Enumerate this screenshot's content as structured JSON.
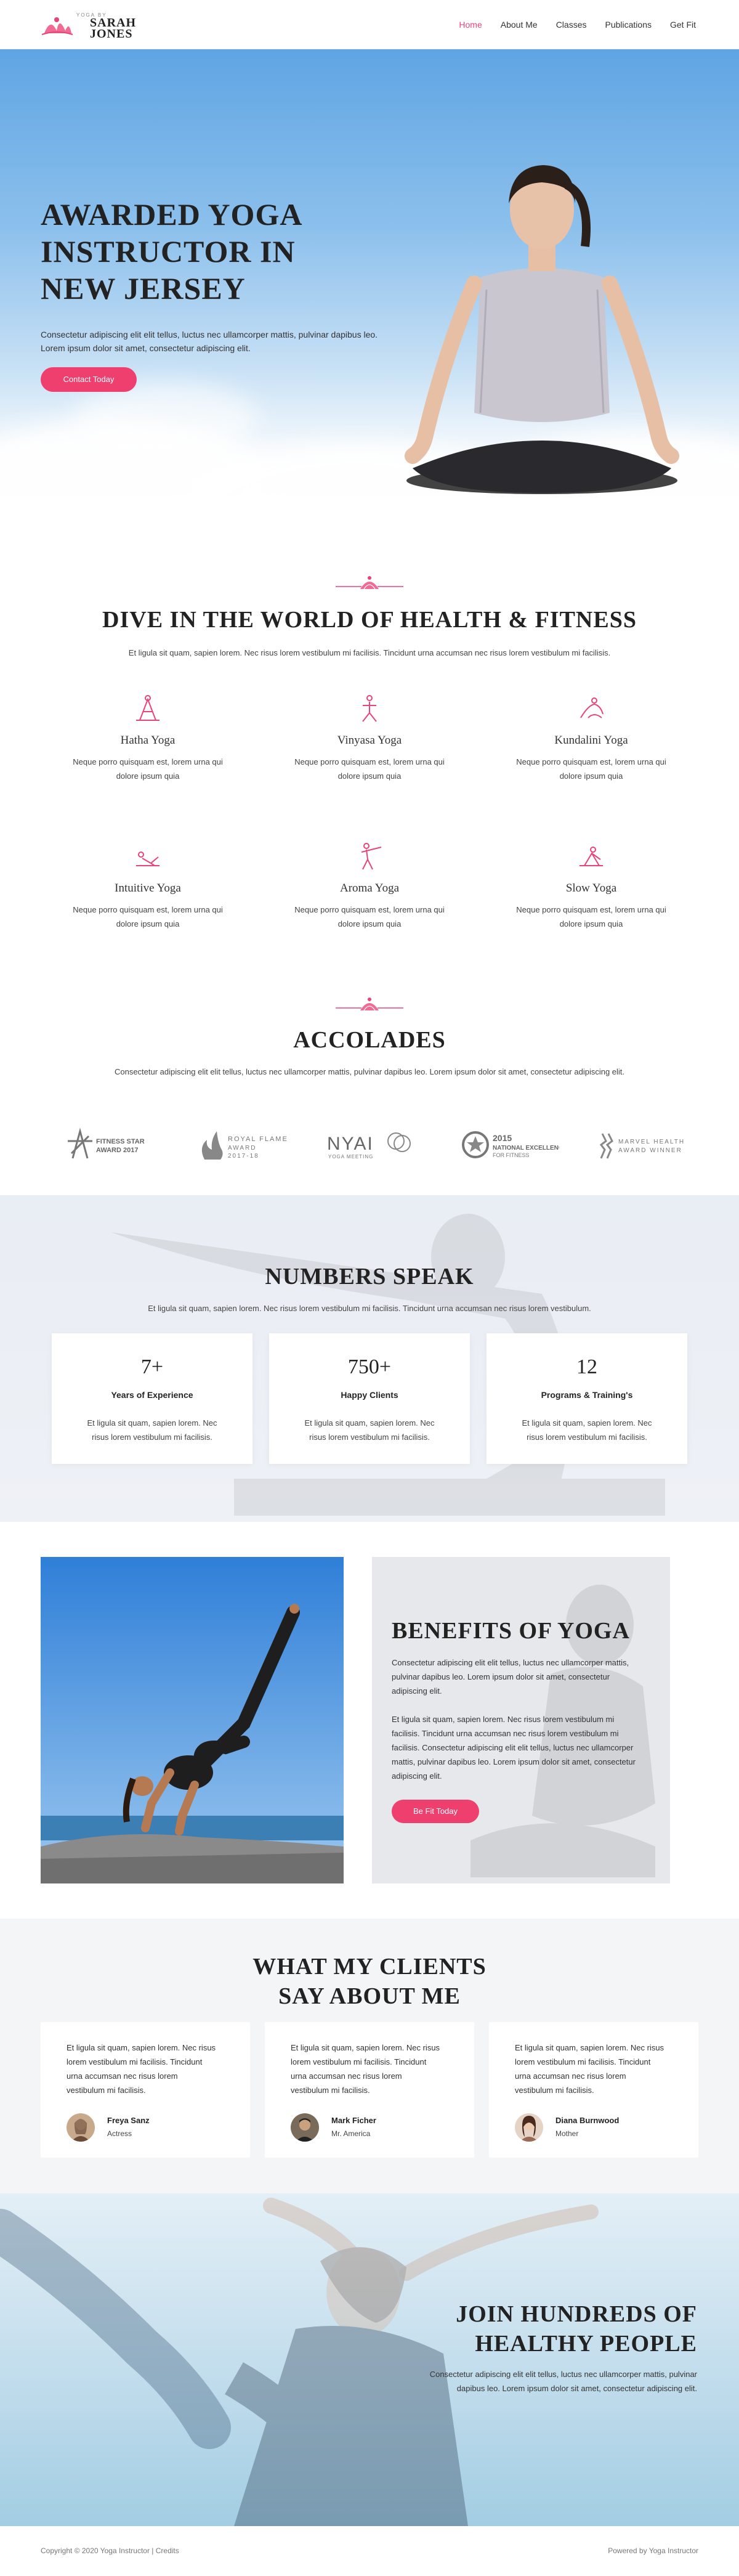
{
  "brand": {
    "tagline": "YOGA BY",
    "name_line1": "SARAH",
    "name_line2": "JONES",
    "accent_color": "#ef3f6f"
  },
  "nav": {
    "items": [
      {
        "label": "Home",
        "active": true
      },
      {
        "label": "About Me",
        "active": false
      },
      {
        "label": "Classes",
        "active": false
      },
      {
        "label": "Publications",
        "active": false
      },
      {
        "label": "Get Fit",
        "active": false
      }
    ]
  },
  "hero": {
    "title_line1": "AWARDED YOGA",
    "title_line2": "INSTRUCTOR IN",
    "title_line3": "NEW JERSEY",
    "desc_line1": "Consectetur adipiscing elit elit tellus, luctus nec ullamcorper mattis, pulvinar dapibus leo.",
    "desc_line2": "Lorem ipsum dolor sit amet, consectetur adipiscing elit.",
    "button": "Contact Today"
  },
  "services": {
    "title": "DIVE IN THE WORLD OF HEALTH & FITNESS",
    "subtitle": "Et ligula sit quam, sapien lorem. Nec risus lorem vestibulum mi facilisis. Tincidunt urna accumsan nec risus lorem vestibulum mi facilisis.",
    "items": [
      {
        "title": "Hatha Yoga",
        "desc_line1": "Neque porro quisquam est, lorem urna qui",
        "desc_line2": "dolore ipsum quia",
        "icon": "hatha-pose-icon"
      },
      {
        "title": "Vinyasa Yoga",
        "desc_line1": "Neque porro quisquam est, lorem urna qui",
        "desc_line2": "dolore ipsum quia",
        "icon": "vinyasa-pose-icon"
      },
      {
        "title": "Kundalini Yoga",
        "desc_line1": "Neque porro quisquam est, lorem urna qui",
        "desc_line2": "dolore ipsum quia",
        "icon": "kundalini-pose-icon"
      },
      {
        "title": "Intuitive Yoga",
        "desc_line1": "Neque porro quisquam est, lorem urna qui",
        "desc_line2": "dolore ipsum quia",
        "icon": "intuitive-pose-icon"
      },
      {
        "title": "Aroma Yoga",
        "desc_line1": "Neque porro quisquam est, lorem urna qui",
        "desc_line2": "dolore ipsum quia",
        "icon": "aroma-pose-icon"
      },
      {
        "title": "Slow Yoga",
        "desc_line1": "Neque porro quisquam est, lorem urna qui",
        "desc_line2": "dolore ipsum quia",
        "icon": "slow-pose-icon"
      }
    ]
  },
  "accolades": {
    "title": "ACCOLADES",
    "subtitle": "Consectetur adipiscing elit elit tellus, luctus nec ullamcorper mattis, pulvinar dapibus leo. Lorem ipsum dolor sit amet, consectetur adipiscing elit.",
    "awards": [
      {
        "line1": "FITNESS STAR",
        "line2": "AWARD 2017"
      },
      {
        "line1": "ROYAL FLAME",
        "line2": "AWARD",
        "line3": "2017-18"
      },
      {
        "line1": "NYAI",
        "line2": "YOGA MEETING"
      },
      {
        "line1": "2015",
        "line2": "NATIONAL EXCELLENCE",
        "line3": "FOR FITNESS"
      },
      {
        "line1": "MARVEL HEALTH",
        "line2": "AWARD WINNER"
      }
    ]
  },
  "numbers": {
    "title": "NUMBERS SPEAK",
    "subtitle": "Et ligula sit quam, sapien lorem. Nec risus lorem vestibulum mi facilisis. Tincidunt urna accumsan nec risus lorem vestibulum.",
    "stats": [
      {
        "value": "7+",
        "label": "Years of Experience",
        "desc_line1": "Et ligula sit quam, sapien lorem. Nec",
        "desc_line2": "risus lorem vestibulum mi facilisis."
      },
      {
        "value": "750+",
        "label": "Happy Clients",
        "desc_line1": "Et ligula sit quam, sapien lorem. Nec",
        "desc_line2": "risus lorem vestibulum mi facilisis."
      },
      {
        "value": "12",
        "label": "Programs & Training's",
        "desc_line1": "Et ligula sit quam, sapien lorem. Nec",
        "desc_line2": "risus lorem vestibulum mi facilisis."
      }
    ]
  },
  "benefits": {
    "title": "BENEFITS OF YOGA",
    "p1_line1": "Consectetur adipiscing elit elit tellus, luctus nec ullamcorper mattis,",
    "p1_line2": "pulvinar dapibus leo. Lorem ipsum dolor sit amet, consectetur",
    "p1_line3": "adipiscing elit.",
    "p2_line1": "Et ligula sit quam, sapien lorem. Nec risus lorem vestibulum mi",
    "p2_line2": "facilisis. Tincidunt urna accumsan nec risus lorem vestibulum mi",
    "p2_line3": "facilisis. Consectetur adipiscing elit elit tellus, luctus nec ullamcorper",
    "p2_line4": "mattis, pulvinar dapibus leo. Lorem ipsum dolor sit amet, consectetur",
    "p2_line5": "adipiscing elit.",
    "button": "Be Fit Today"
  },
  "testimonials": {
    "title_line1": "WHAT MY CLIENTS",
    "title_line2": "SAY ABOUT ME",
    "items": [
      {
        "text_line1": "Et ligula sit quam, sapien lorem. Nec risus",
        "text_line2": "lorem vestibulum mi facilisis. Tincidunt",
        "text_line3": "urna accumsan nec risus lorem",
        "text_line4": "vestibulum mi facilisis.",
        "name": "Freya Sanz",
        "role": "Actress"
      },
      {
        "text_line1": "Et ligula sit quam, sapien lorem. Nec risus",
        "text_line2": "lorem vestibulum mi facilisis. Tincidunt",
        "text_line3": "urna accumsan nec risus lorem",
        "text_line4": "vestibulum mi facilisis.",
        "name": "Mark Ficher",
        "role": "Mr. America"
      },
      {
        "text_line1": "Et ligula sit quam, sapien lorem. Nec risus",
        "text_line2": "lorem vestibulum mi facilisis. Tincidunt",
        "text_line3": "urna accumsan nec risus lorem",
        "text_line4": "vestibulum mi facilisis.",
        "name": "Diana Burnwood",
        "role": "Mother"
      }
    ]
  },
  "join": {
    "title_line1": "JOIN HUNDREDS OF",
    "title_line2": "HEALTHY PEOPLE",
    "desc_line1": "Consectetur adipiscing elit elit tellus, luctus nec ullamcorper mattis, pulvinar",
    "desc_line2": "dapibus leo. Lorem ipsum dolor sit amet, consectetur adipiscing elit."
  },
  "footer": {
    "copyright": "Copyright © 2020 Yoga Instructor | Credits",
    "powered": "Powered by Yoga Instructor"
  }
}
